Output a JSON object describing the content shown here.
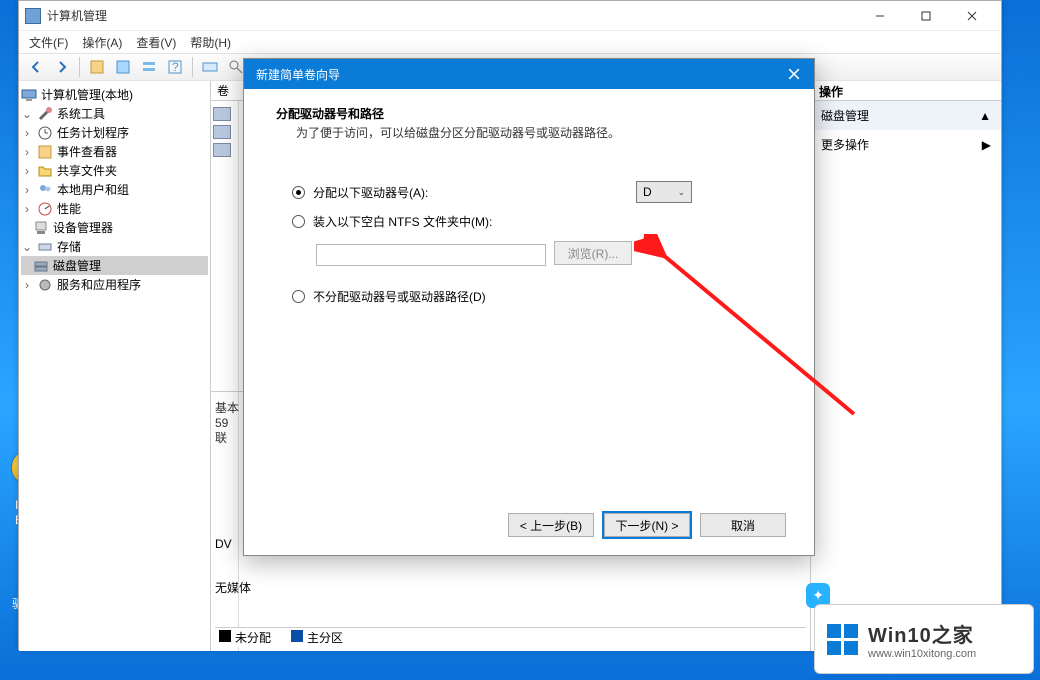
{
  "desktop": {
    "icon1_line1": "I",
    "icon1_line2": "E",
    "driver_label": "驱"
  },
  "main_window": {
    "title": "计算机管理",
    "menu": [
      "文件(F)",
      "操作(A)",
      "查看(V)",
      "帮助(H)"
    ],
    "tree": {
      "root": "计算机管理(本地)",
      "system_tools": "系统工具",
      "task_scheduler": "任务计划程序",
      "event_viewer": "事件查看器",
      "shared_folders": "共享文件夹",
      "local_users": "本地用户和组",
      "performance": "性能",
      "device_manager": "设备管理器",
      "storage": "存储",
      "disk_mgmt": "磁盘管理",
      "services": "服务和应用程序"
    },
    "center": {
      "header": "卷",
      "basic_line1": "基本",
      "basic_line2": "59",
      "basic_line3": "联",
      "dv_line": "DV",
      "dv_sub": "无媒体",
      "legend_unalloc": "未分配",
      "legend_primary": "主分区"
    },
    "actions": {
      "header": "操作",
      "disk_mgmt": "磁盘管理",
      "more": "更多操作"
    }
  },
  "dialog": {
    "title": "新建简单卷向导",
    "heading": "分配驱动器号和路径",
    "subheading": "为了便于访问，可以给磁盘分区分配驱动器号或驱动器路径。",
    "opt1": "分配以下驱动器号(A):",
    "drive_letter": "D",
    "opt2": "装入以下空白 NTFS 文件夹中(M):",
    "browse": "浏览(R)...",
    "opt3": "不分配驱动器号或驱动器路径(D)",
    "back": "< 上一步(B)",
    "next": "下一步(N) >",
    "cancel": "取消"
  },
  "watermark": {
    "title": "Win10之家",
    "url": "www.win10xitong.com"
  }
}
